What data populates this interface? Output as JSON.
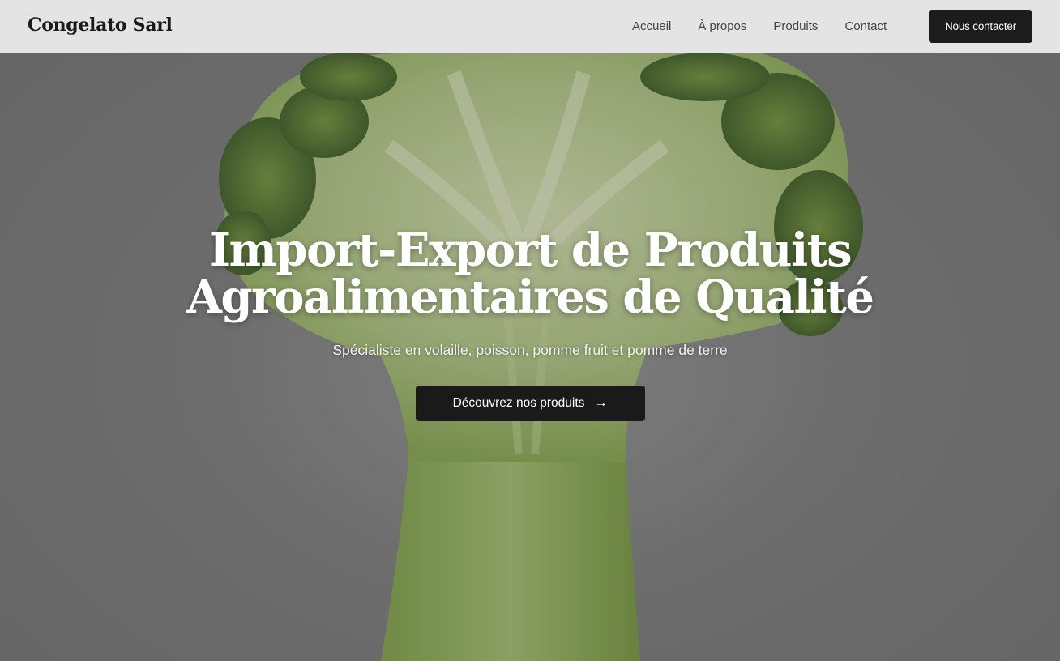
{
  "header": {
    "brand": "Congelato Sarl",
    "nav": [
      "Accueil",
      "À propos",
      "Produits",
      "Contact"
    ],
    "cta": "Nous contacter"
  },
  "hero": {
    "title_line1": "Import-Export de Produits",
    "title_line2": "Agroalimentaires de Qualité",
    "subtitle": "Spécialiste en volaille, poisson, pomme fruit et pomme de terre",
    "button_label": "Découvrez nos produits",
    "button_icon": "arrow-right-icon",
    "button_arrow": "→",
    "background_image": "broccoli-cross-section-image"
  },
  "colors": {
    "dark": "#1a1a1a",
    "header_bg": "#eeeeee",
    "broccoli_green": "#8aa860"
  }
}
